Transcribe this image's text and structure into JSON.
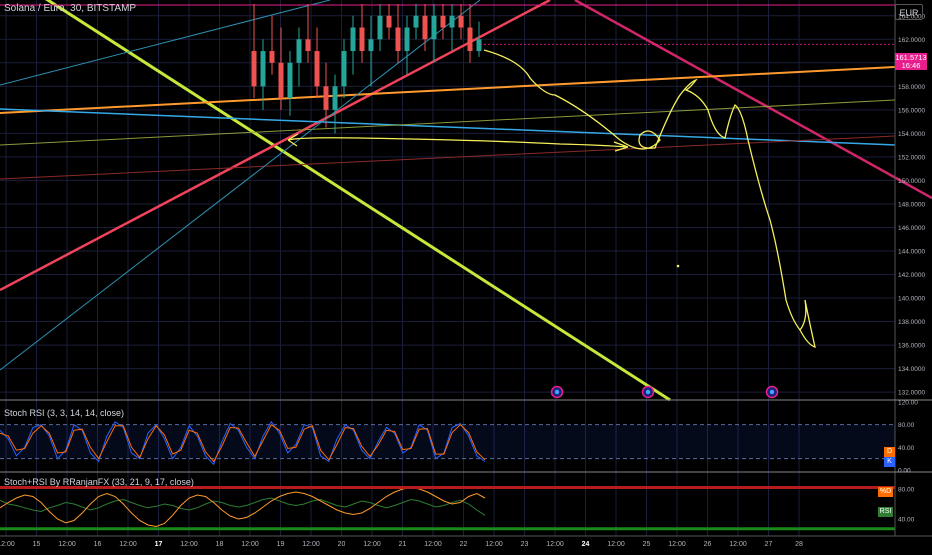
{
  "header": {
    "title": "Solana / Euro, 30, BITSTAMP",
    "currency": "EUR"
  },
  "last_price": {
    "price": "161.5713",
    "countdown": "16:46"
  },
  "colors": {
    "background": "#000000",
    "grid": "#1b1e3a",
    "up": "#26a69a",
    "down": "#ef5350",
    "price_tag": "#e91e8c"
  },
  "chart_data": [
    {
      "type": "candlestick",
      "title": "Solana / Euro, 30, BITSTAMP",
      "y_ticks": [
        "164.0000",
        "162.0000",
        "160.0000",
        "158.0000",
        "156.0000",
        "154.0000",
        "152.0000",
        "150.0000",
        "148.0000",
        "146.0000",
        "144.0000",
        "142.0000",
        "140.0000",
        "138.0000",
        "136.0000",
        "134.0000",
        "132.0000"
      ],
      "ylim": [
        131.5,
        165
      ],
      "x_ticks": [
        "12:00",
        "15",
        "12:00",
        "16",
        "12:00",
        "17",
        "12:00",
        "18",
        "12:00",
        "19",
        "12:00",
        "20",
        "12:00",
        "21",
        "12:00",
        "22",
        "12:00",
        "23",
        "12:00",
        "24",
        "12:00",
        "25",
        "12:00",
        "26",
        "12:00",
        "27",
        "28"
      ],
      "x_ticks_bold": [
        "17",
        "24"
      ],
      "grid": true,
      "candles": [
        {
          "o": 161,
          "h": 165,
          "l": 157,
          "c": 158
        },
        {
          "o": 158,
          "h": 162,
          "l": 156,
          "c": 161
        },
        {
          "o": 161,
          "h": 164,
          "l": 159,
          "c": 160
        },
        {
          "o": 160,
          "h": 163,
          "l": 156,
          "c": 157
        },
        {
          "o": 157,
          "h": 161,
          "l": 155.5,
          "c": 160
        },
        {
          "o": 160,
          "h": 163,
          "l": 158,
          "c": 162
        },
        {
          "o": 162,
          "h": 165,
          "l": 160,
          "c": 161
        },
        {
          "o": 161,
          "h": 163,
          "l": 157,
          "c": 158
        },
        {
          "o": 158,
          "h": 160,
          "l": 154.5,
          "c": 156
        },
        {
          "o": 156,
          "h": 159,
          "l": 154,
          "c": 158
        },
        {
          "o": 158,
          "h": 162,
          "l": 157,
          "c": 161
        },
        {
          "o": 161,
          "h": 164,
          "l": 159,
          "c": 163
        },
        {
          "o": 163,
          "h": 165,
          "l": 160,
          "c": 161
        },
        {
          "o": 161,
          "h": 164,
          "l": 158,
          "c": 162
        },
        {
          "o": 162,
          "h": 165,
          "l": 161,
          "c": 164
        },
        {
          "o": 164,
          "h": 165,
          "l": 162,
          "c": 163
        },
        {
          "o": 163,
          "h": 165,
          "l": 160,
          "c": 161
        },
        {
          "o": 161,
          "h": 164,
          "l": 159,
          "c": 163
        },
        {
          "o": 163,
          "h": 165,
          "l": 162,
          "c": 164
        },
        {
          "o": 164,
          "h": 165,
          "l": 161,
          "c": 162
        },
        {
          "o": 162,
          "h": 165,
          "l": 160,
          "c": 164
        },
        {
          "o": 164,
          "h": 165,
          "l": 162,
          "c": 163
        },
        {
          "o": 163,
          "h": 165,
          "l": 161,
          "c": 164
        },
        {
          "o": 164,
          "h": 165,
          "l": 162,
          "c": 163
        },
        {
          "o": 163,
          "h": 165,
          "l": 160,
          "c": 161
        },
        {
          "o": 161,
          "h": 163.5,
          "l": 160.5,
          "c": 162
        }
      ],
      "drawings": [
        {
          "name": "support-line-lime",
          "color": "#c6e83a",
          "width": 3,
          "from": [
            -30,
            -50
          ],
          "to": [
            670,
            400
          ]
        },
        {
          "name": "trend-line-red-rising",
          "color": "#f0435b",
          "width": 2.5,
          "from": [
            0,
            290
          ],
          "to": [
            550,
            0
          ]
        },
        {
          "name": "trend-line-crimson-falling",
          "color": "#d1256a",
          "width": 2.5,
          "from": [
            575,
            0
          ],
          "to": [
            932,
            198
          ]
        },
        {
          "name": "trend-line-orange",
          "color": "#ff9a2e",
          "width": 2,
          "from": [
            0,
            113
          ],
          "to": [
            895,
            67
          ]
        },
        {
          "name": "trend-line-cyan",
          "color": "#35a9e8",
          "width": 1.5,
          "from": [
            0,
            109
          ],
          "to": [
            895,
            145
          ]
        },
        {
          "name": "trend-line-olive",
          "color": "#8a9a3a",
          "width": 1,
          "from": [
            0,
            145
          ],
          "to": [
            895,
            100
          ]
        },
        {
          "name": "trend-line-maroon",
          "color": "#8a2a2a",
          "width": 1,
          "from": [
            0,
            179
          ],
          "to": [
            895,
            136
          ]
        },
        {
          "name": "channel-line-teal-1",
          "color": "#2f8fb0",
          "width": 1,
          "from": [
            0,
            85
          ],
          "to": [
            330,
            0
          ]
        },
        {
          "name": "channel-line-teal-2",
          "color": "#2f8fb0",
          "width": 1,
          "from": [
            0,
            370
          ],
          "to": [
            480,
            0
          ]
        },
        {
          "name": "resistance-line-magenta",
          "color": "#e91e8c",
          "width": 1,
          "from": [
            0,
            5
          ],
          "to": [
            895,
            5
          ]
        }
      ],
      "markers": [
        557,
        648,
        772
      ]
    },
    {
      "type": "line",
      "title": "Stoch RSI (3, 3, 14, 14, close)",
      "y_ticks": [
        "120.00",
        "80.00",
        "40.00",
        "0.00"
      ],
      "ylim": [
        0,
        120
      ],
      "bands": [
        20,
        80
      ],
      "series": [
        {
          "color": "#2962ff",
          "values": [
            70,
            55,
            25,
            40,
            75,
            80,
            60,
            20,
            35,
            80,
            70,
            30,
            15,
            60,
            85,
            75,
            30,
            20,
            65,
            80,
            55,
            20,
            40,
            78,
            60,
            25,
            10,
            50,
            82,
            70,
            40,
            20,
            60,
            85,
            65,
            30,
            45,
            80,
            75,
            25,
            15,
            55,
            80,
            70,
            35,
            20,
            50,
            75,
            65,
            30,
            40,
            80,
            70,
            20,
            30,
            75,
            82,
            60,
            25,
            15
          ]
        },
        {
          "color": "#ff6d00",
          "values": [
            65,
            60,
            35,
            38,
            65,
            78,
            65,
            30,
            32,
            70,
            72,
            40,
            20,
            50,
            78,
            78,
            40,
            22,
            55,
            78,
            62,
            28,
            35,
            70,
            65,
            32,
            15,
            42,
            75,
            74,
            48,
            24,
            52,
            80,
            70,
            38,
            40,
            72,
            78,
            35,
            18,
            45,
            75,
            73,
            42,
            24,
            44,
            70,
            68,
            36,
            38,
            72,
            73,
            28,
            28,
            66,
            80,
            66,
            32,
            18
          ]
        }
      ],
      "legend": [
        "D",
        "K"
      ]
    },
    {
      "type": "line",
      "title": "Stoch+RSI By RRanjanFX (33, 21, 9, 17, close)",
      "y_ticks": [
        "80.00",
        "40.00"
      ],
      "ylim": [
        20,
        100
      ],
      "bands": [
        27,
        82
      ],
      "series": [
        {
          "color": "#2e7d32",
          "values": [
            65,
            60,
            58,
            55,
            52,
            50,
            55,
            58,
            62,
            60,
            56,
            52,
            55,
            60,
            64,
            66,
            62,
            58,
            55,
            57,
            60,
            58,
            54,
            52,
            55,
            60,
            64,
            62,
            58,
            56,
            58,
            62,
            66,
            68,
            64,
            60,
            58,
            60,
            64,
            66,
            62,
            58,
            56,
            60,
            64,
            62,
            58,
            55,
            58,
            62,
            66,
            64,
            60,
            56,
            58,
            62,
            65,
            60,
            52,
            45
          ]
        },
        {
          "color": "#ff9a2e",
          "values": [
            55,
            62,
            68,
            72,
            70,
            62,
            50,
            40,
            35,
            38,
            48,
            60,
            70,
            74,
            70,
            60,
            48,
            38,
            32,
            30,
            34,
            45,
            58,
            68,
            72,
            70,
            62,
            52,
            44,
            40,
            42,
            48,
            56,
            64,
            70,
            74,
            76,
            74,
            70,
            64,
            58,
            52,
            48,
            46,
            48,
            54,
            62,
            70,
            76,
            80,
            82,
            80,
            76,
            70,
            64,
            60,
            62,
            70,
            74,
            68
          ]
        }
      ],
      "legend": [
        "%D",
        "RSI"
      ]
    }
  ]
}
